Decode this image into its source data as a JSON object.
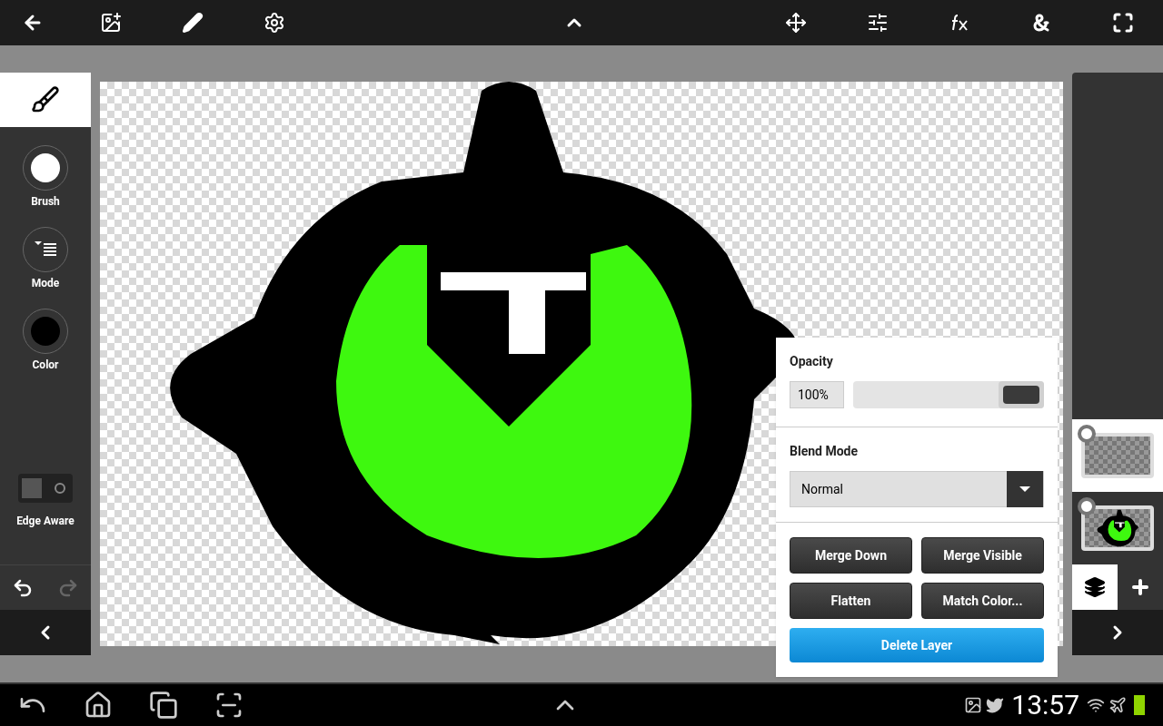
{
  "toolbar": {
    "expanded": false
  },
  "tool_panel": {
    "tool_selected": true,
    "options": [
      {
        "kind": "brush",
        "label": "Brush"
      },
      {
        "kind": "mode",
        "label": "Mode"
      },
      {
        "kind": "color",
        "label": "Color",
        "color": "#000000"
      }
    ],
    "edge_aware": {
      "label": "Edge Aware",
      "on": false
    },
    "undo_disabled": false,
    "redo_disabled": true
  },
  "layer_panel": {
    "opacity": {
      "label": "Opacity",
      "value": "100%",
      "level": 1
    },
    "blend_mode": {
      "label": "Blend Mode",
      "value": "Normal"
    },
    "buttons": [
      "Merge Down",
      "Merge Visible",
      "Flatten",
      "Match Color..."
    ],
    "delete_button": "Delete Layer"
  },
  "layers": [
    {
      "kind": "empty",
      "selected": true
    },
    {
      "kind": "drawing",
      "selected": false
    }
  ],
  "status_bar": {
    "time": "13:57"
  }
}
